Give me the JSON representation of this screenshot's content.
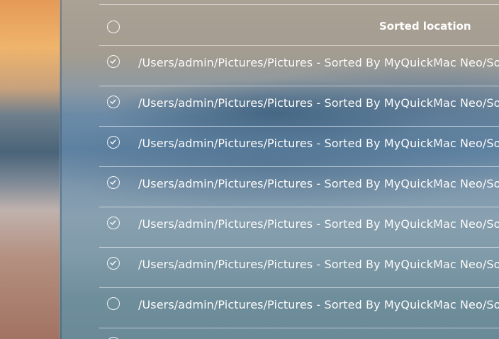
{
  "header": {
    "column_title": "Sorted location"
  },
  "rows": [
    {
      "path": "/Users/admin/Pictures/Pictures - Sorted By MyQuickMac Neo/So",
      "checked": true
    },
    {
      "path": "/Users/admin/Pictures/Pictures - Sorted By MyQuickMac Neo/So",
      "checked": true
    },
    {
      "path": "/Users/admin/Pictures/Pictures - Sorted By MyQuickMac Neo/So",
      "checked": true
    },
    {
      "path": "/Users/admin/Pictures/Pictures - Sorted By MyQuickMac Neo/So",
      "checked": true
    },
    {
      "path": "/Users/admin/Pictures/Pictures - Sorted By MyQuickMac Neo/So",
      "checked": true
    },
    {
      "path": "/Users/admin/Pictures/Pictures - Sorted By MyQuickMac Neo/So",
      "checked": true
    },
    {
      "path": "/Users/admin/Pictures/Pictures - Sorted By MyQuickMac Neo/So",
      "checked": false
    }
  ]
}
